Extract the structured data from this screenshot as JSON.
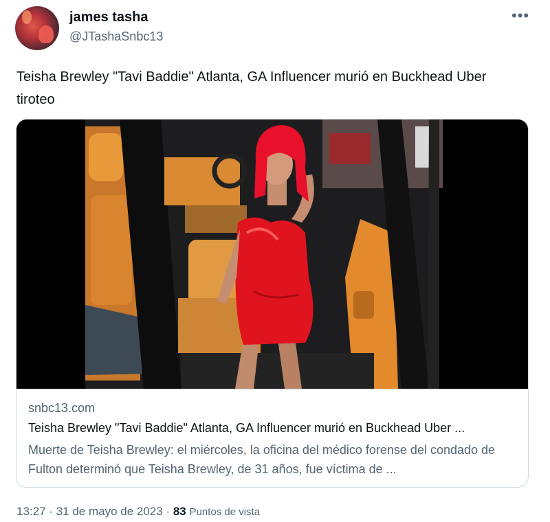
{
  "author": {
    "name": "james tasha",
    "handle": "@JTashaSnbc13"
  },
  "tweet": {
    "text": "Teisha Brewley \"Tavi Baddie\" Atlanta, GA Influencer murió en Buckhead Uber tiroteo"
  },
  "card": {
    "domain": "snbc13.com",
    "title": "Teisha Brewley \"Tavi Baddie\" Atlanta, GA Influencer murió en Buckhead Uber ...",
    "description": "Muerte de Teisha Brewley: el miércoles, la oficina del médico forense del condado de Fulton determinó que Teisha Brewley, de 31 años, fue víctima de ..."
  },
  "meta": {
    "time": "13:27",
    "separator": "·",
    "date": "31 de mayo de 2023",
    "views_count": "83",
    "views_label": "Puntos de vista"
  },
  "icons": {
    "more": "more-horizontal-icon"
  },
  "colors": {
    "text_primary": "#0f1419",
    "text_secondary": "#536471",
    "border": "#cfd9de",
    "dress_red": "#e0141e",
    "interior_orange": "#e38a2c"
  }
}
